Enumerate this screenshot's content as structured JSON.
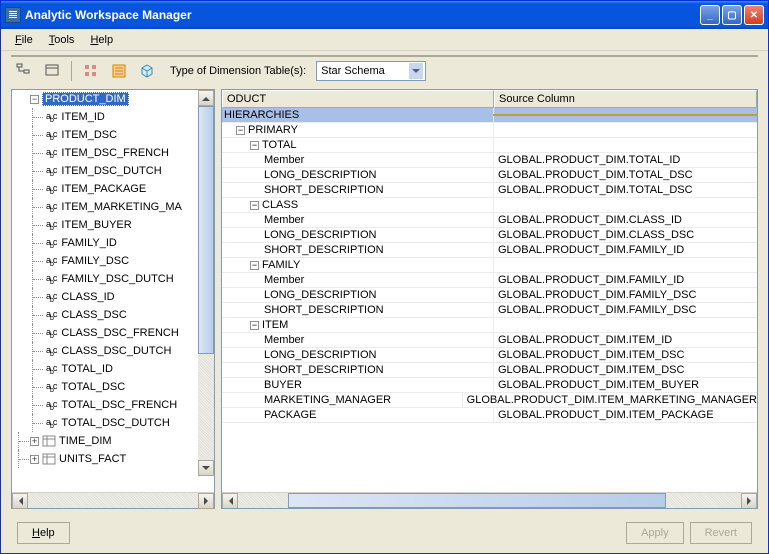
{
  "window": {
    "title": "Analytic Workspace Manager"
  },
  "menu": {
    "file": "File",
    "tools": "Tools",
    "help": "Help"
  },
  "toolbar": {
    "dim_label": "Type of Dimension Table(s):",
    "dim_combo": "Star Schema"
  },
  "tree": {
    "root": "PRODUCT_DIM",
    "items": [
      "ITEM_ID",
      "ITEM_DSC",
      "ITEM_DSC_FRENCH",
      "ITEM_DSC_DUTCH",
      "ITEM_PACKAGE",
      "ITEM_MARKETING_MA",
      "ITEM_BUYER",
      "FAMILY_ID",
      "FAMILY_DSC",
      "FAMILY_DSC_DUTCH",
      "CLASS_ID",
      "CLASS_DSC",
      "CLASS_DSC_FRENCH",
      "CLASS_DSC_DUTCH",
      "TOTAL_ID",
      "TOTAL_DSC",
      "TOTAL_DSC_FRENCH",
      "TOTAL_DSC_DUTCH"
    ],
    "tail": [
      "TIME_DIM",
      "UNITS_FACT"
    ]
  },
  "grid": {
    "col1": "ODUCT",
    "col2": "Source Column",
    "rows": [
      {
        "t": "sel",
        "i": 0,
        "l": "HIERARCHIES",
        "v": ""
      },
      {
        "t": "exp",
        "i": 1,
        "l": "PRIMARY",
        "v": ""
      },
      {
        "t": "exp",
        "i": 2,
        "l": "TOTAL",
        "v": ""
      },
      {
        "t": "",
        "i": 3,
        "l": "Member",
        "v": "GLOBAL.PRODUCT_DIM.TOTAL_ID"
      },
      {
        "t": "",
        "i": 3,
        "l": "LONG_DESCRIPTION",
        "v": "GLOBAL.PRODUCT_DIM.TOTAL_DSC"
      },
      {
        "t": "",
        "i": 3,
        "l": "SHORT_DESCRIPTION",
        "v": "GLOBAL.PRODUCT_DIM.TOTAL_DSC"
      },
      {
        "t": "exp",
        "i": 2,
        "l": "CLASS",
        "v": ""
      },
      {
        "t": "",
        "i": 3,
        "l": "Member",
        "v": "GLOBAL.PRODUCT_DIM.CLASS_ID"
      },
      {
        "t": "",
        "i": 3,
        "l": "LONG_DESCRIPTION",
        "v": "GLOBAL.PRODUCT_DIM.CLASS_DSC"
      },
      {
        "t": "",
        "i": 3,
        "l": "SHORT_DESCRIPTION",
        "v": "GLOBAL.PRODUCT_DIM.FAMILY_ID"
      },
      {
        "t": "exp",
        "i": 2,
        "l": "FAMILY",
        "v": ""
      },
      {
        "t": "",
        "i": 3,
        "l": "Member",
        "v": "GLOBAL.PRODUCT_DIM.FAMILY_ID"
      },
      {
        "t": "",
        "i": 3,
        "l": "LONG_DESCRIPTION",
        "v": "GLOBAL.PRODUCT_DIM.FAMILY_DSC"
      },
      {
        "t": "",
        "i": 3,
        "l": "SHORT_DESCRIPTION",
        "v": "GLOBAL.PRODUCT_DIM.FAMILY_DSC"
      },
      {
        "t": "exp",
        "i": 2,
        "l": "ITEM",
        "v": ""
      },
      {
        "t": "",
        "i": 3,
        "l": "Member",
        "v": "GLOBAL.PRODUCT_DIM.ITEM_ID"
      },
      {
        "t": "",
        "i": 3,
        "l": "LONG_DESCRIPTION",
        "v": "GLOBAL.PRODUCT_DIM.ITEM_DSC"
      },
      {
        "t": "",
        "i": 3,
        "l": "SHORT_DESCRIPTION",
        "v": "GLOBAL.PRODUCT_DIM.ITEM_DSC"
      },
      {
        "t": "",
        "i": 3,
        "l": "BUYER",
        "v": "GLOBAL.PRODUCT_DIM.ITEM_BUYER"
      },
      {
        "t": "",
        "i": 3,
        "l": "MARKETING_MANAGER",
        "v": "GLOBAL.PRODUCT_DIM.ITEM_MARKETING_MANAGER"
      },
      {
        "t": "",
        "i": 3,
        "l": "PACKAGE",
        "v": "GLOBAL.PRODUCT_DIM.ITEM_PACKAGE"
      }
    ]
  },
  "footer": {
    "help": "Help",
    "apply": "Apply",
    "revert": "Revert"
  }
}
